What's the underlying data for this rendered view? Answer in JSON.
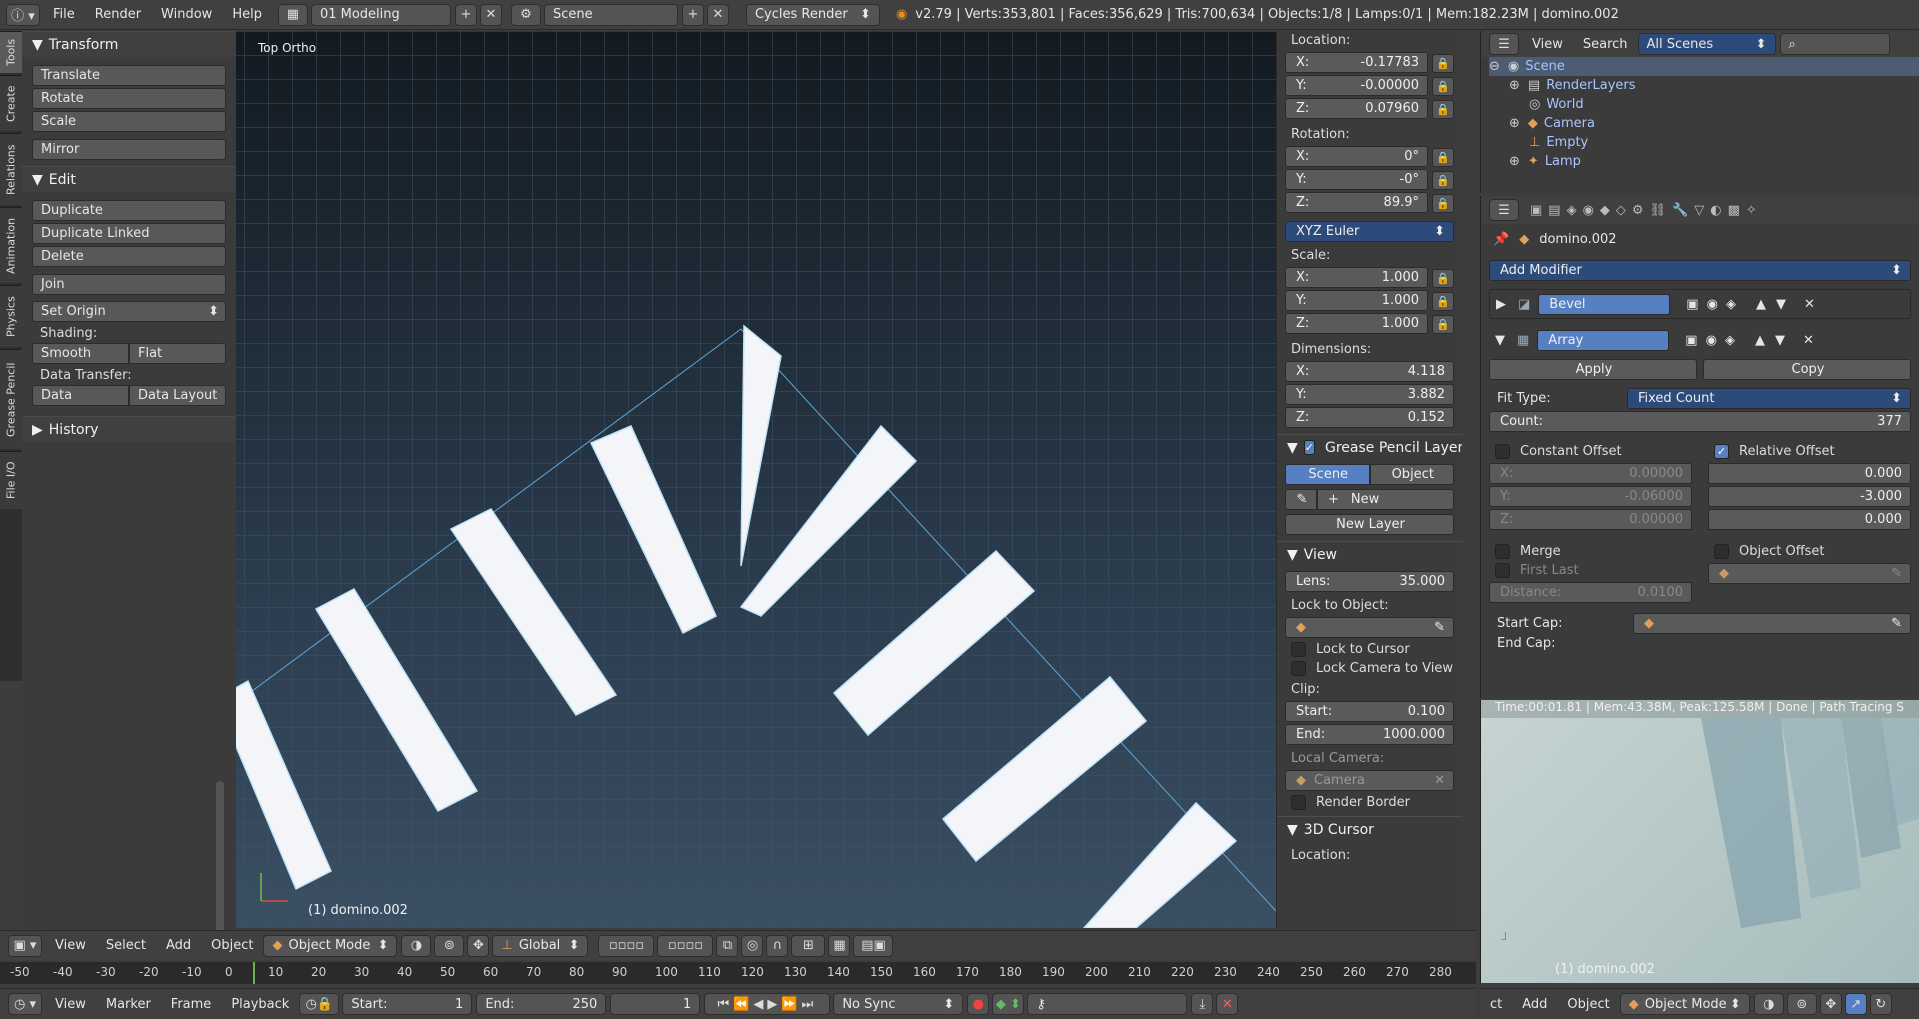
{
  "topbar": {
    "menus": [
      "File",
      "Render",
      "Window",
      "Help"
    ],
    "layout": "01 Modeling",
    "scene": "Scene",
    "engine": "Cycles Render",
    "stats": "v2.79 | Verts:353,801 | Faces:356,629 | Tris:700,634 | Objects:1/8 | Lamps:0/1 | Mem:182.23M | domino.002"
  },
  "tooltabs": [
    "Tools",
    "Create",
    "Relations",
    "Animation",
    "Physics",
    "Grease Pencil",
    "File I/O"
  ],
  "toolshelf": {
    "transform_title": "Transform",
    "transform": [
      "Translate",
      "Rotate",
      "Scale"
    ],
    "mirror": "Mirror",
    "edit_title": "Edit",
    "edit": [
      "Duplicate",
      "Duplicate Linked",
      "Delete"
    ],
    "join": "Join",
    "set_origin": "Set Origin",
    "shading_label": "Shading:",
    "smooth": "Smooth",
    "flat": "Flat",
    "data_transfer_label": "Data Transfer:",
    "data": "Data",
    "data_layout": "Data Layout",
    "history": "History"
  },
  "viewport": {
    "view_name": "Top Ortho",
    "object_label": "(1) domino.002"
  },
  "npanel": {
    "location_label": "Location:",
    "location": {
      "x": "-0.17783",
      "y": "-0.00000",
      "z": "0.07960"
    },
    "rotation_label": "Rotation:",
    "rotation": {
      "x": "0°",
      "y": "-0°",
      "z": "89.9°"
    },
    "rotation_mode": "XYZ Euler",
    "scale_label": "Scale:",
    "scale": {
      "x": "1.000",
      "y": "1.000",
      "z": "1.000"
    },
    "dimensions_label": "Dimensions:",
    "dimensions": {
      "x": "4.118",
      "y": "3.882",
      "z": "0.152"
    },
    "gp_layers": "Grease Pencil Layers",
    "scene_tab": "Scene",
    "object_tab": "Object",
    "new": "New",
    "new_layer": "New Layer",
    "view_title": "View",
    "lens_label": "Lens:",
    "lens": "35.000",
    "lock_to_object": "Lock to Object:",
    "lock_to_cursor": "Lock to Cursor",
    "lock_camera": "Lock Camera to View",
    "clip_label": "Clip:",
    "clip_start_label": "Start:",
    "clip_start": "0.100",
    "clip_end_label": "End:",
    "clip_end": "1000.000",
    "local_camera": "Local Camera:",
    "camera": "Camera",
    "render_border": "Render Border",
    "cursor_title": "3D Cursor",
    "cursor_location": "Location:"
  },
  "outliner": {
    "view": "View",
    "search": "Search",
    "scenes": "All Scenes",
    "rows": [
      "Scene",
      "RenderLayers",
      "World",
      "Camera",
      "Empty",
      "Lamp"
    ]
  },
  "properties": {
    "object_name": "domino.002",
    "add_modifier": "Add Modifier",
    "mod1": "Bevel",
    "mod2": "Array",
    "apply": "Apply",
    "copy": "Copy",
    "fit_type_label": "Fit Type:",
    "fit_type": "Fixed Count",
    "count_label": "Count:",
    "count": "377",
    "constant_offset": "Constant Offset",
    "relative_offset": "Relative Offset",
    "const": {
      "x": "0.00000",
      "y": "-0.06000",
      "z": "0.00000"
    },
    "rel": {
      "x": "0.000",
      "y": "-3.000",
      "z": "0.000"
    },
    "merge": "Merge",
    "object_offset": "Object Offset",
    "first_last": "First Last",
    "distance_label": "Distance:",
    "distance": "0.0100",
    "start_cap": "Start Cap:",
    "end_cap": "End Cap:"
  },
  "render": {
    "status": "Time:00:01.81 | Mem:43.38M, Peak:125.58M | Done | Path Tracing S",
    "object_label": "(1) domino.002"
  },
  "vp_header": {
    "view": "View",
    "select": "Select",
    "add": "Add",
    "object": "Object",
    "mode": "Object Mode",
    "orientation": "Global"
  },
  "timeline_ticks": [
    "-50",
    "-40",
    "-30",
    "-20",
    "-10",
    "0",
    "10",
    "20",
    "30",
    "40",
    "50",
    "60",
    "70",
    "80",
    "90",
    "100",
    "110",
    "120",
    "130",
    "140",
    "150",
    "160",
    "170",
    "180",
    "190",
    "200",
    "210",
    "220",
    "230",
    "240",
    "250",
    "260",
    "270",
    "280"
  ],
  "bottom": {
    "view": "View",
    "marker": "Marker",
    "frame": "Frame",
    "playback": "Playback",
    "start_label": "Start:",
    "start": "1",
    "end_label": "End:",
    "end": "250",
    "current": "1",
    "sync": "No Sync"
  },
  "rt_bottom": {
    "ct": "ct",
    "add": "Add",
    "object": "Object",
    "mode": "Object Mode"
  }
}
